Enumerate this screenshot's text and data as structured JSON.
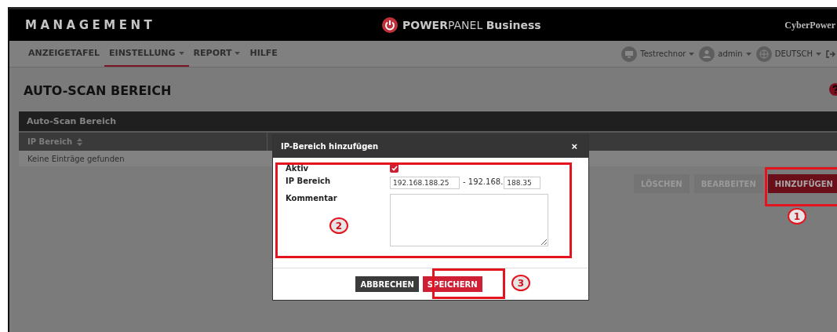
{
  "header": {
    "title": "MANAGEMENT",
    "product_bold": "POWER",
    "product_light": "PANEL",
    "product_suffix": "Business",
    "brand": "CyberPower"
  },
  "nav": {
    "items": [
      {
        "label": "ANZEIGETAFEL",
        "dropdown": false,
        "selected": false
      },
      {
        "label": "EINSTELLUNG",
        "dropdown": true,
        "selected": true
      },
      {
        "label": "REPORT",
        "dropdown": true,
        "selected": false
      },
      {
        "label": "HILFE",
        "dropdown": false,
        "selected": false
      }
    ],
    "right": [
      {
        "kind": "monitor",
        "label": "Testrechnor"
      },
      {
        "kind": "user",
        "label": "admin"
      },
      {
        "kind": "globe",
        "label": "DEUTSCH"
      }
    ]
  },
  "page": {
    "title": "AUTO-SCAN BEREICH"
  },
  "panel": {
    "title": "Auto-Scan Bereich",
    "columns": [
      {
        "label": "IP Bereich",
        "sortable": true
      }
    ],
    "empty_message": "Keine Einträge gefunden",
    "buttons": [
      {
        "label": "LÖSCHEN",
        "kind": "secondary",
        "disabled": true
      },
      {
        "label": "BEARBEITEN",
        "kind": "secondary",
        "disabled": true
      },
      {
        "label": "HINZUFÜGEN",
        "kind": "primary",
        "disabled": false
      }
    ]
  },
  "dialog": {
    "title": "IP-Bereich hinzufügen",
    "close": "×",
    "fields": [
      {
        "label": "Aktiv",
        "kind": "checkbox",
        "checked": true
      },
      {
        "label": "IP Bereich",
        "kind": "ip-range",
        "start": "192.168.188.25",
        "prefix": "- 192.168.",
        "end": "188.35"
      },
      {
        "label": "Kommentar",
        "kind": "textarea"
      }
    ],
    "buttons": [
      {
        "label": "ABBRECHEN",
        "kind": "secondary"
      },
      {
        "label": "SPEICHERN",
        "kind": "primary"
      }
    ]
  },
  "annotations": [
    {
      "number": "1"
    },
    {
      "number": "2"
    },
    {
      "number": "3"
    }
  ]
}
